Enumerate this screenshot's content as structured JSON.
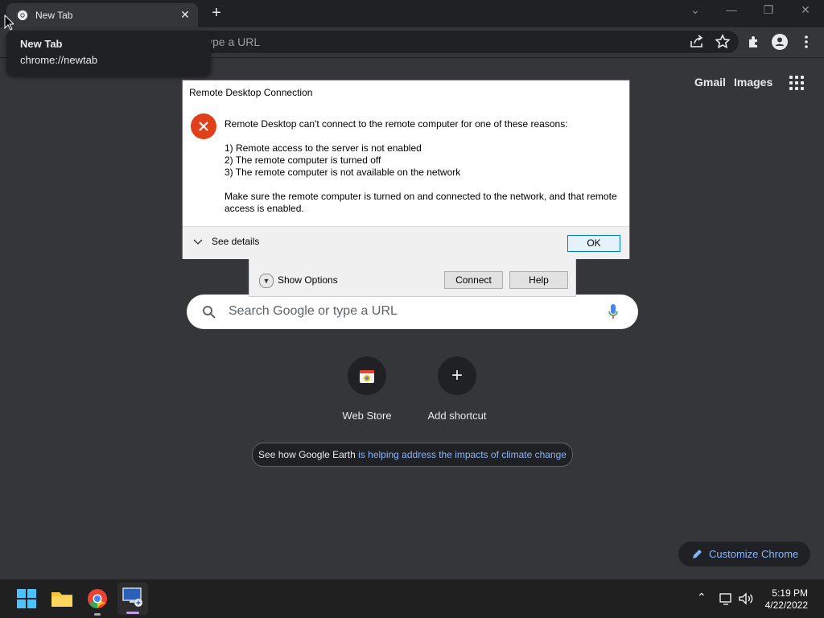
{
  "browser": {
    "tab_title": "New Tab",
    "tooltip_title": "New Tab",
    "tooltip_url": "chrome://newtab",
    "omnibox_placeholder": "ype a URL"
  },
  "ntp": {
    "gmail": "Gmail",
    "images": "Images",
    "search_placeholder": "Search Google or type a URL",
    "shortcuts": [
      {
        "label": "Web Store",
        "icon": "web-store-icon"
      },
      {
        "label": "Add shortcut",
        "icon": "plus-icon"
      }
    ],
    "promo_prefix": "See how Google Earth",
    "promo_link": "is helping address the impacts of climate change",
    "customize": "Customize Chrome"
  },
  "rdp_window": {
    "show_options": "Show Options",
    "connect": "Connect",
    "help": "Help"
  },
  "dialog": {
    "title": "Remote Desktop Connection",
    "message": "Remote Desktop can't connect to the remote computer for one of these reasons:",
    "reason1": "1) Remote access to the server is not enabled",
    "reason2": "2) The remote computer is turned off",
    "reason3": "3) The remote computer is not available on the network",
    "advice1": "Make sure the remote computer is turned on and connected to the network, and that remote",
    "advice2": "access is enabled.",
    "see_details": "See details",
    "ok": "OK"
  },
  "taskbar": {
    "time": "5:19 PM",
    "date": "4/22/2022"
  },
  "colors": {
    "page_bg": "#35363a",
    "error_red": "#e0401a",
    "link_blue": "#8ab4f8"
  }
}
